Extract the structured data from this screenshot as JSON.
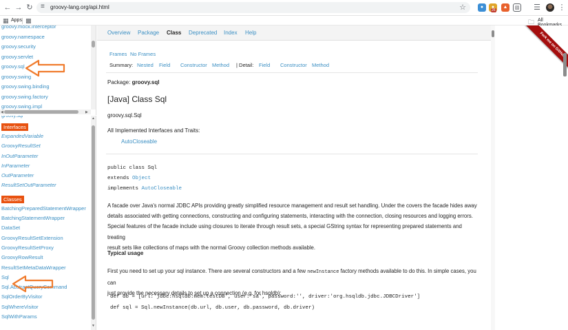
{
  "browser": {
    "url": "groovy-lang.org/api.html",
    "extension_badge": "26",
    "bookmarks": {
      "apps_label": "Apps",
      "all_bookmarks_label": "All Bookmarks"
    }
  },
  "package_frame": {
    "items": [
      "groovy.mock.interceptor",
      "groovy.namespace",
      "groovy.security",
      "groovy.servlet",
      "groovy.sql",
      "groovy.swing",
      "groovy.swing.binding",
      "groovy.swing.factory",
      "groovy.swing.impl"
    ]
  },
  "class_frame": {
    "cutoff_text": "groovy.sql",
    "interfaces_header": "Interfaces",
    "interfaces": [
      "ExpandedVariable",
      "GroovyResultSet",
      "InOutParameter",
      "InParameter",
      "OutParameter",
      "ResultSetOutParameter"
    ],
    "classes_header": "Classes",
    "classes": [
      "BatchingPreparedStatementWrapper",
      "BatchingStatementWrapper",
      "DataSet",
      "GroovyResultSetExtension",
      "GroovyResultSetProxy",
      "GroovyRowResult",
      "ResultSetMetaDataWrapper",
      "Sql",
      "Sql.AbstractQueryCommand",
      "SqlOrderByVisitor",
      "SqlWhereVisitor",
      "SqlWithParams"
    ]
  },
  "main": {
    "topnav": {
      "overview": "Overview",
      "package": "Package",
      "class": "Class",
      "deprecated": "Deprecated",
      "index": "Index",
      "help": "Help"
    },
    "frames": "Frames",
    "no_frames": "No Frames",
    "summary_label": "Summary:",
    "summary_nested": "Nested",
    "summary_field": "Field",
    "summary_constructor": "Constructor",
    "summary_method": "Method",
    "detail_label": "| Detail:",
    "detail_field": "Field",
    "detail_constructor": "Constructor",
    "detail_method": "Method",
    "package_label": "Package:",
    "package_name": "groovy.sql",
    "class_title": "[Java] Class Sql",
    "fqcn": "groovy.sql.Sql",
    "impl_label": "All Implemented Interfaces and Traits:",
    "impl_link": "AutoCloseable",
    "decl_line1": "public class Sql",
    "decl_extends": "extends ",
    "decl_object": "Object",
    "decl_implements": "implements ",
    "decl_autocloseable": "AutoCloseable",
    "para1_l1": "A facade over Java's normal JDBC APIs providing greatly simplified resource management and result set handling. Under the covers the facade hides away",
    "para1_l2": "details associated with getting connections, constructing and configuring statements, interacting with the connection, closing resources and logging errors.",
    "para1_l3": "Special features of the facade include using closures to iterate through result sets, a special GString syntax for representing prepared statements and treating",
    "para1_l4": "result sets like collections of maps with the normal Groovy collection methods available.",
    "typical_usage": "Typical usage",
    "para2_a": "First you need to set up your sql instance. There are several constructors and a few ",
    "para2_code": "newInstance",
    "para2_b": " factory methods available to do this. In simple cases, you can",
    "para2_l2": "just provide the necessary details to set up a connection (e.g. for hsqldb):",
    "code_l1": "def db = [url:'jdbc:hsqldb:mem:testDB', user:'sa', password:'', driver:'org.hsqldb.jdbc.JDBCDriver']",
    "code_l2": "def sql = Sql.newInstance(db.url, db.user, db.password, db.driver)"
  },
  "ribbon": {
    "text": "Fork me on GitHub"
  },
  "colors": {
    "link": "#3b8fc3",
    "section_header": "#e8510f",
    "annotation_arrow": "#f07b2c",
    "ribbon": "#a50e0e"
  }
}
